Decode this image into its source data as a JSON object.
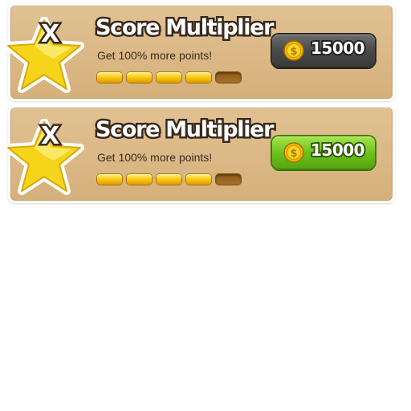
{
  "upgrades": [
    {
      "title": "Score Multiplier",
      "description": "Get 100% more points!",
      "badge_letter": "X",
      "level": 4,
      "max_level": 5,
      "price": "15000",
      "price_state": "disabled",
      "price_color": "#4a4a4a"
    },
    {
      "title": "Score Multiplier",
      "description": "Get 100% more points!",
      "badge_letter": "X",
      "level": 4,
      "max_level": 5,
      "price": "15000",
      "price_state": "enabled",
      "price_color": "#6ec21c"
    }
  ],
  "icons": {
    "badge": "star-icon",
    "currency": "coin-icon"
  },
  "colors": {
    "card_bg": "#d9b47f",
    "segment_on": "#f7c30b",
    "segment_off": "#a7712b"
  }
}
